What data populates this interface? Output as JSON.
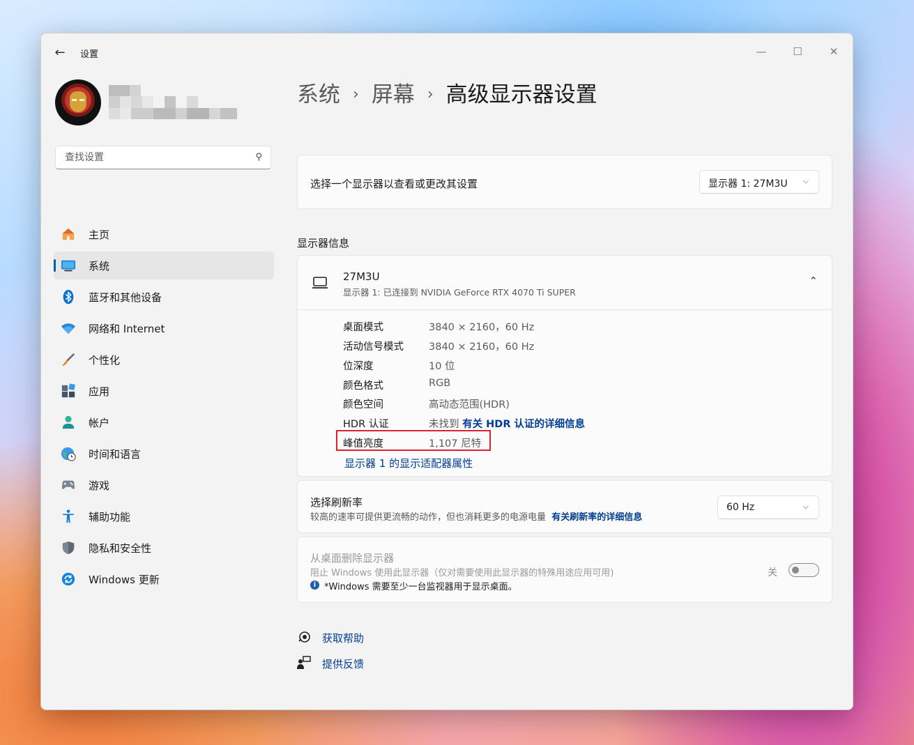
{
  "window": {
    "title": "设置"
  },
  "sidebar": {
    "search_placeholder": "查找设置",
    "items": [
      {
        "label": "主页",
        "icon": "home-icon"
      },
      {
        "label": "系统",
        "icon": "system-icon",
        "active": true
      },
      {
        "label": "蓝牙和其他设备",
        "icon": "bluetooth-icon"
      },
      {
        "label": "网络和 Internet",
        "icon": "wifi-icon"
      },
      {
        "label": "个性化",
        "icon": "brush-icon"
      },
      {
        "label": "应用",
        "icon": "apps-icon"
      },
      {
        "label": "帐户",
        "icon": "account-icon"
      },
      {
        "label": "时间和语言",
        "icon": "globe-clock-icon"
      },
      {
        "label": "游戏",
        "icon": "gamepad-icon"
      },
      {
        "label": "辅助功能",
        "icon": "accessibility-icon"
      },
      {
        "label": "隐私和安全性",
        "icon": "shield-icon"
      },
      {
        "label": "Windows 更新",
        "icon": "update-icon"
      }
    ]
  },
  "breadcrumb": {
    "level1": "系统",
    "level2": "屏幕",
    "current": "高级显示器设置"
  },
  "monitor_select": {
    "label": "选择一个显示器以查看或更改其设置",
    "value": "显示器 1: 27M3U"
  },
  "display_info": {
    "section_title": "显示器信息",
    "monitor_name": "27M3U",
    "monitor_desc": "显示器 1: 已连接到 NVIDIA GeForce RTX 4070 Ti SUPER",
    "rows": [
      {
        "key": "桌面模式",
        "value": "3840 × 2160，60 Hz"
      },
      {
        "key": "活动信号模式",
        "value": "3840 × 2160，60 Hz"
      },
      {
        "key": "位深度",
        "value": "10 位"
      },
      {
        "key": "颜色格式",
        "value": "RGB"
      },
      {
        "key": "颜色空间",
        "value": "高动态范围(HDR)"
      },
      {
        "key": "HDR 认证",
        "value": "未找到",
        "link": "有关 HDR 认证的详细信息"
      },
      {
        "key": "峰值亮度",
        "value": "1,107 尼特"
      }
    ],
    "adapter_link": "显示器 1 的显示适配器属性",
    "highlight_color": "#e0212d"
  },
  "refresh_rate": {
    "title": "选择刷新率",
    "desc": "较高的速率可提供更流畅的动作，但也消耗更多的电源电量",
    "link": "有关刷新率的详细信息",
    "value": "60 Hz"
  },
  "remove_display": {
    "title": "从桌面删除显示器",
    "desc": "阻止 Windows 使用此显示器（仅对需要使用此显示器的特殊用途应用可用)",
    "note": "*Windows 需要至少一台监视器用于显示桌面。",
    "toggle_label": "关",
    "toggle_on": false
  },
  "footer": {
    "help": "获取帮助",
    "feedback": "提供反馈"
  },
  "colors": {
    "accent": "#005fb8",
    "link": "#003e92"
  }
}
